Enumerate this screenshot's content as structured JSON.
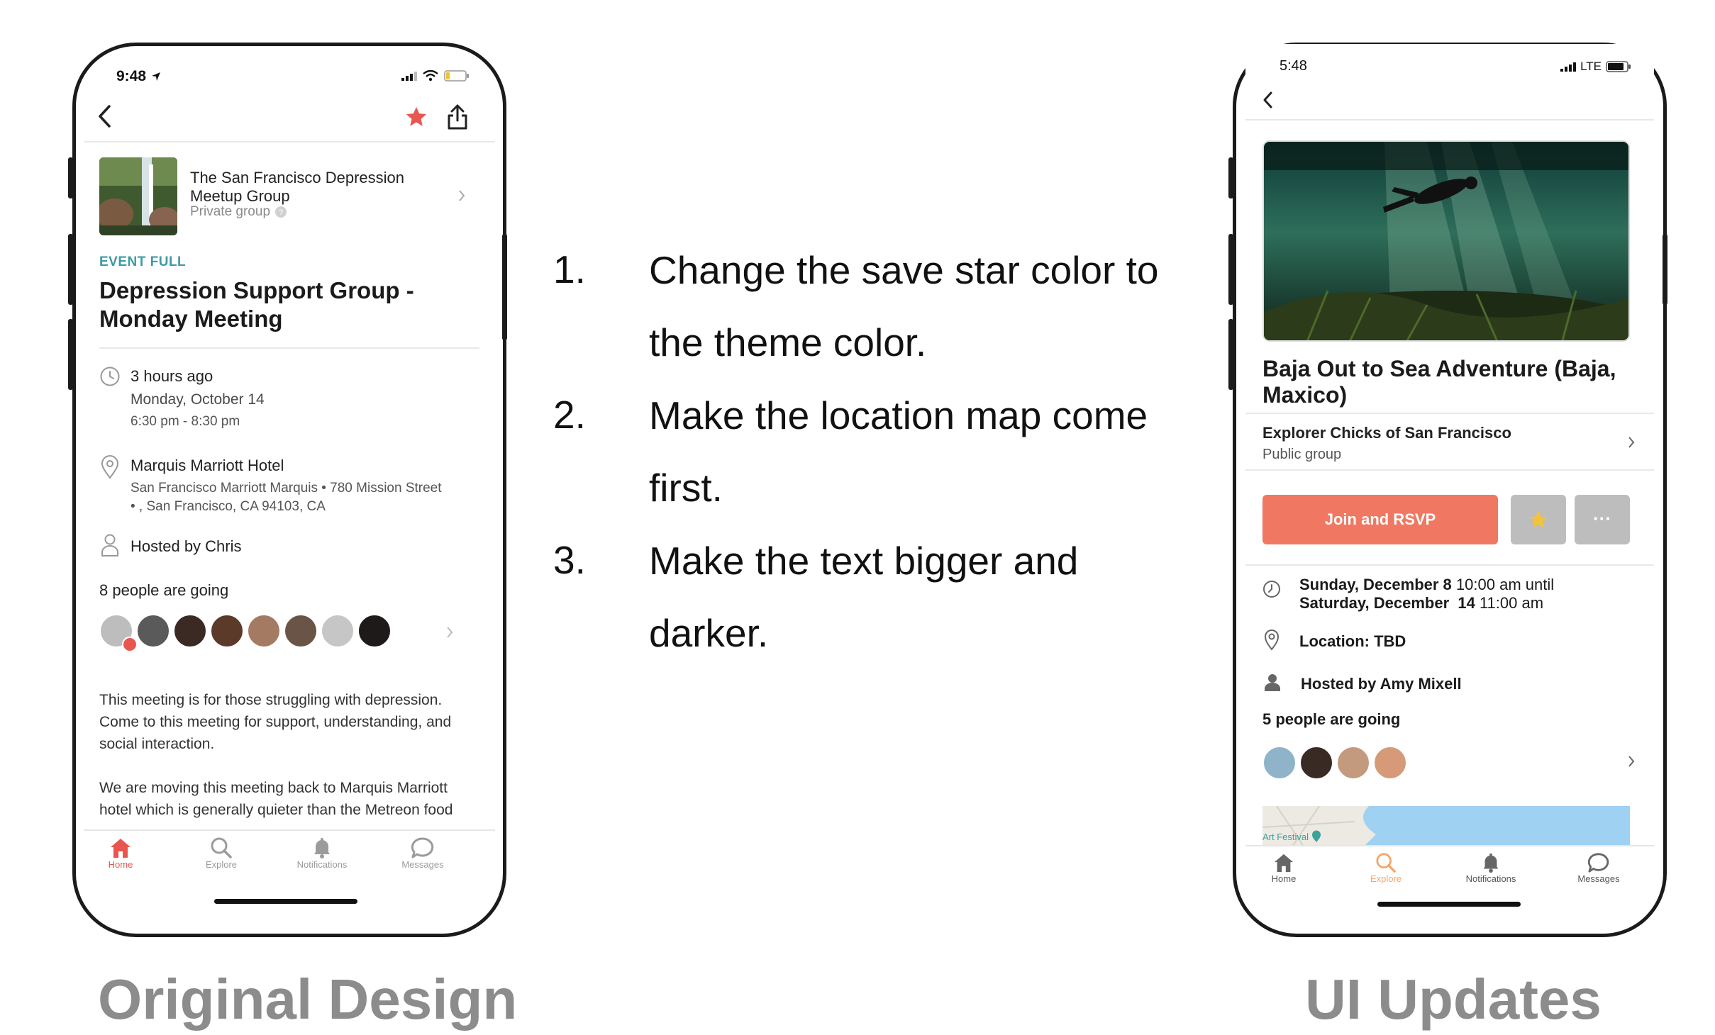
{
  "left_phone": {
    "status_time": "9:48",
    "group": {
      "name": "The San Francisco Depression Meetup Group",
      "privacy": "Private group"
    },
    "event_status": "EVENT FULL",
    "event_title": "Depression Support Group - Monday Meeting",
    "time": {
      "relative": "3 hours ago",
      "date": "Monday, October 14",
      "range": "6:30 pm - 8:30 pm"
    },
    "location": {
      "name": "Marquis Marriott Hotel",
      "address_line1": "San Francisco Marriott Marquis • 780 Mission Street",
      "address_line2": "• , San Francisco, CA 94103, CA"
    },
    "host": "Hosted by Chris",
    "attendees_label": "8 people are going",
    "description_p1": "This meeting is for those struggling with depression. Come to this meeting for support, understanding, and social interaction.",
    "description_p2": "We are moving this meeting back to Marquis Marriott hotel which is generally quieter than the Metreon food court.",
    "tabs": [
      {
        "label": "Home",
        "icon": "home-icon"
      },
      {
        "label": "Explore",
        "icon": "search-icon"
      },
      {
        "label": "Notifications",
        "icon": "bell-icon"
      },
      {
        "label": "Messages",
        "icon": "chat-icon"
      }
    ],
    "colors": {
      "star": "#e8564f",
      "home_active": "#e8564f"
    }
  },
  "instructions": {
    "items": [
      {
        "num": "1.",
        "text": "Change the save star color to the theme color."
      },
      {
        "num": "2.",
        "text": "Make the location map come first."
      },
      {
        "num": "3.",
        "text": "Make the text bigger and darker."
      }
    ]
  },
  "captions": {
    "left": "Original Design",
    "right": "UI Updates"
  },
  "right_phone": {
    "status_time": "5:48",
    "network": "LTE",
    "event_title": "Baja Out to Sea Adventure (Baja, Maxico)",
    "group": {
      "name": "Explorer Chicks of San Francisco",
      "privacy": "Public group"
    },
    "join_button": "Join and RSVP",
    "more_button": "···",
    "time": {
      "start_day": "Sunday, December 8",
      "start_time": "10:00 am until",
      "end_day": "Saturday, December  14",
      "end_time": "11:00 am"
    },
    "location": "Location: TBD",
    "host": "Hosted by Amy Mixell",
    "attendees_label": "5 people are going",
    "map_label": "Art Festival",
    "tabs": [
      {
        "label": "Home",
        "icon": "home-icon"
      },
      {
        "label": "Explore",
        "icon": "search-icon"
      },
      {
        "label": "Notifications",
        "icon": "bell-icon"
      },
      {
        "label": "Messages",
        "icon": "chat-icon"
      }
    ],
    "colors": {
      "theme": "#f07862",
      "star": "#f5c33b",
      "explore_active": "#f3a66b"
    }
  }
}
